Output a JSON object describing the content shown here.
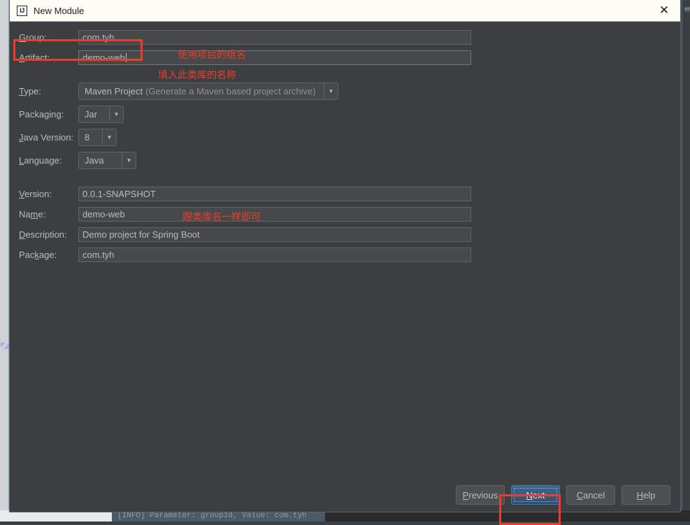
{
  "background": {
    "console_line": "[INFO] Parameter: groupId, Value: com.tyh",
    "right_edge_text": "er"
  },
  "window": {
    "title": "New Module",
    "logo_text": "IJ",
    "close_icon": "✕"
  },
  "form": {
    "group": {
      "label_prefix": "",
      "label_accel": "G",
      "label_suffix": "roup:",
      "value": "com.tyh"
    },
    "artifact": {
      "label_accel": "A",
      "label_suffix": "rtifact:",
      "value": "demo-web"
    },
    "type": {
      "label_accel": "T",
      "label_suffix": "ype:",
      "value_main": "Maven Project",
      "value_note": "(Generate a Maven based project archive)"
    },
    "packaging": {
      "label_pre": "Packa",
      "label_accel": "g",
      "label_suffix": "ing:",
      "value": "Jar"
    },
    "java_version": {
      "label_accel": "J",
      "label_suffix": "ava Version:",
      "value": "8"
    },
    "language": {
      "label_accel": "L",
      "label_suffix": "anguage:",
      "value": "Java"
    },
    "version": {
      "label_accel": "V",
      "label_suffix": "ersion:",
      "value": "0.0.1-SNAPSHOT"
    },
    "name": {
      "label_pre": "Na",
      "label_accel": "m",
      "label_suffix": "e:",
      "value": "demo-web"
    },
    "description": {
      "label_accel": "D",
      "label_suffix": "escription:",
      "value": "Demo project for Spring Boot"
    },
    "package": {
      "label_pre": "Pac",
      "label_accel": "k",
      "label_suffix": "age:",
      "value": "com.tyh"
    }
  },
  "annotations": {
    "color": "#f03b2c",
    "group_note": "使用项目的组名",
    "artifact_note": "填入此类库的名称",
    "name_note": "跟类库名一样即可"
  },
  "buttons": {
    "previous": {
      "accel": "P",
      "rest": "revious"
    },
    "next": {
      "accel": "N",
      "rest": "ext"
    },
    "cancel": {
      "accel": "C",
      "rest": "ancel"
    },
    "help": {
      "accel": "H",
      "rest": "elp"
    }
  }
}
